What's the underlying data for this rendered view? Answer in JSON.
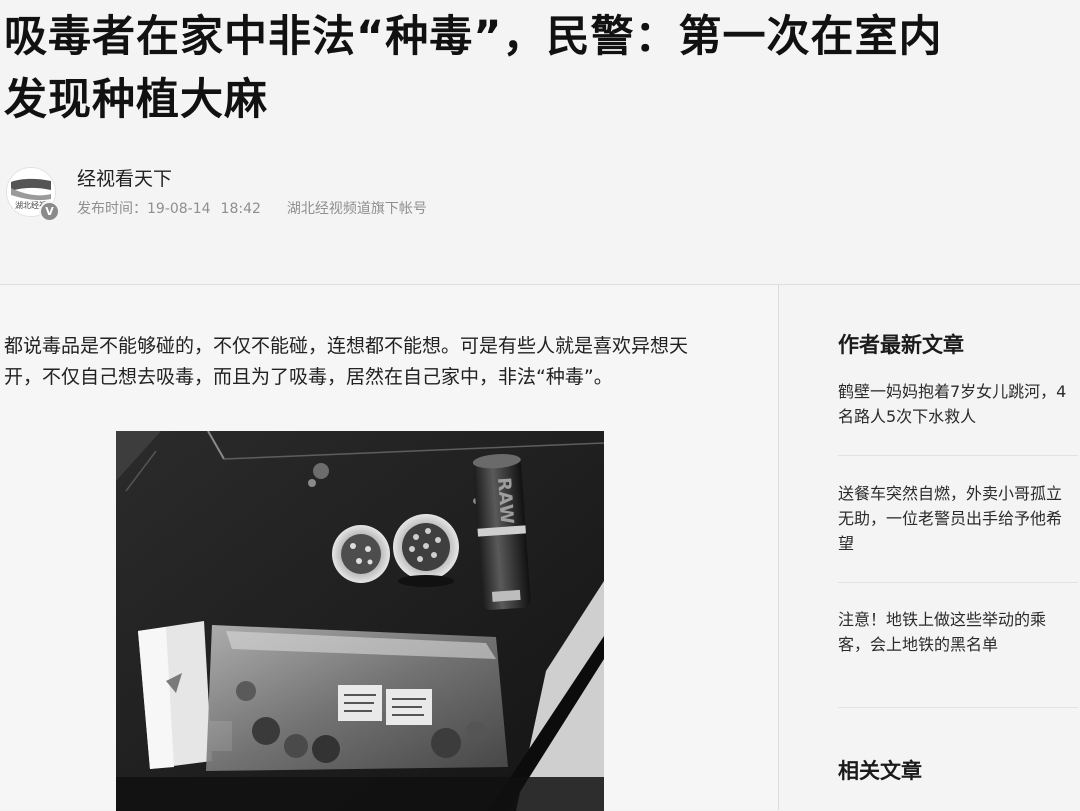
{
  "article": {
    "title_lines": [
      "吸毒者在家中非法“种毒”，民警：第一次在室内",
      "发现种植大麻"
    ],
    "author": {
      "name": "经视看天下",
      "avatar_icon": "hubei-jingshi-logo",
      "avatar_text": "湖北经视",
      "verified_icon": "verified-v-icon",
      "verified_text": "V"
    },
    "meta": {
      "publish_label": "发布时间：",
      "date": "19-08-14",
      "time": "18:42",
      "account": "湖北经视频道旗下帐号"
    },
    "intro_lines": [
      "都说毒品是不能够碰的，不仅不能碰，连想都不能想。可是有些人就是喜欢异想天",
      "开，不仅自己想去吸毒，而且为了吸毒，居然在自己家中，非法“种毒”。"
    ],
    "photo": {
      "can_label": "RAW"
    }
  },
  "sidebar": {
    "latest_heading": "作者最新文章",
    "latest_items": [
      {
        "lines": [
          "鹤壁一妈妈抱着7岁女儿跳河，4",
          "名路人5次下水救人"
        ]
      },
      {
        "lines": [
          "送餐车突然自燃，外卖小哥孤立",
          "无助，一位老警员出手给予他希",
          "望"
        ]
      },
      {
        "lines": [
          "注意！地铁上做这些举动的乘",
          "客，会上地铁的黑名单"
        ]
      }
    ],
    "related_heading": "相关文章"
  },
  "colors": {
    "background": "#f4f4f4",
    "text": "#222222",
    "meta": "#8f8f8f"
  }
}
